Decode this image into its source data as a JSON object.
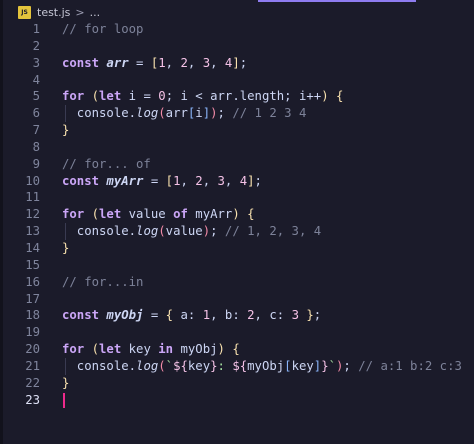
{
  "breadcrumb": {
    "file_icon_text": "JS",
    "file_name": "test.js",
    "separator": ">",
    "more": "..."
  },
  "editor": {
    "active_line": 23,
    "lines": [
      {
        "n": "1",
        "guide": false,
        "tokens": [
          {
            "t": "// for loop",
            "c": "comment"
          }
        ]
      },
      {
        "n": "2",
        "guide": false,
        "tokens": []
      },
      {
        "n": "3",
        "guide": false,
        "tokens": [
          {
            "t": "const ",
            "c": "keyword"
          },
          {
            "t": "arr",
            "c": "var"
          },
          {
            "t": " = ",
            "c": "op"
          },
          {
            "t": "[",
            "c": "bracket1"
          },
          {
            "t": "1",
            "c": "number"
          },
          {
            "t": ", ",
            "c": "punct"
          },
          {
            "t": "2",
            "c": "number"
          },
          {
            "t": ", ",
            "c": "punct"
          },
          {
            "t": "3",
            "c": "number"
          },
          {
            "t": ", ",
            "c": "punct"
          },
          {
            "t": "4",
            "c": "number"
          },
          {
            "t": "]",
            "c": "bracket1"
          },
          {
            "t": ";",
            "c": "punct"
          }
        ]
      },
      {
        "n": "4",
        "guide": false,
        "tokens": []
      },
      {
        "n": "5",
        "guide": false,
        "tokens": [
          {
            "t": "for ",
            "c": "keyword"
          },
          {
            "t": "(",
            "c": "bracket1"
          },
          {
            "t": "let ",
            "c": "keyword"
          },
          {
            "t": "i",
            "c": "ident"
          },
          {
            "t": " = ",
            "c": "op"
          },
          {
            "t": "0",
            "c": "number"
          },
          {
            "t": "; ",
            "c": "punct"
          },
          {
            "t": "i",
            "c": "ident"
          },
          {
            "t": " < ",
            "c": "op"
          },
          {
            "t": "arr",
            "c": "ident"
          },
          {
            "t": ".length; ",
            "c": "ident"
          },
          {
            "t": "i",
            "c": "ident"
          },
          {
            "t": "++",
            "c": "op"
          },
          {
            "t": ")",
            "c": "bracket1"
          },
          {
            "t": " ",
            "c": "punct"
          },
          {
            "t": "{",
            "c": "bracket1"
          }
        ]
      },
      {
        "n": "6",
        "guide": true,
        "tokens": [
          {
            "t": "  console.",
            "c": "ident"
          },
          {
            "t": "log",
            "c": "func"
          },
          {
            "t": "(",
            "c": "bracket2"
          },
          {
            "t": "arr",
            "c": "ident"
          },
          {
            "t": "[",
            "c": "bracket3"
          },
          {
            "t": "i",
            "c": "ident"
          },
          {
            "t": "]",
            "c": "bracket3"
          },
          {
            "t": ")",
            "c": "bracket2"
          },
          {
            "t": "; ",
            "c": "punct"
          },
          {
            "t": "// 1 2 3 4",
            "c": "comment"
          }
        ]
      },
      {
        "n": "7",
        "guide": false,
        "tokens": [
          {
            "t": "}",
            "c": "bracket1"
          }
        ]
      },
      {
        "n": "8",
        "guide": false,
        "tokens": []
      },
      {
        "n": "9",
        "guide": false,
        "tokens": [
          {
            "t": "// for... of",
            "c": "comment"
          }
        ]
      },
      {
        "n": "10",
        "guide": false,
        "tokens": [
          {
            "t": "const ",
            "c": "keyword"
          },
          {
            "t": "myArr",
            "c": "var"
          },
          {
            "t": " = ",
            "c": "op"
          },
          {
            "t": "[",
            "c": "bracket1"
          },
          {
            "t": "1",
            "c": "number"
          },
          {
            "t": ", ",
            "c": "punct"
          },
          {
            "t": "2",
            "c": "number"
          },
          {
            "t": ", ",
            "c": "punct"
          },
          {
            "t": "3",
            "c": "number"
          },
          {
            "t": ", ",
            "c": "punct"
          },
          {
            "t": "4",
            "c": "number"
          },
          {
            "t": "]",
            "c": "bracket1"
          },
          {
            "t": ";",
            "c": "punct"
          }
        ]
      },
      {
        "n": "11",
        "guide": false,
        "tokens": []
      },
      {
        "n": "12",
        "guide": false,
        "tokens": [
          {
            "t": "for ",
            "c": "keyword"
          },
          {
            "t": "(",
            "c": "bracket1"
          },
          {
            "t": "let ",
            "c": "keyword"
          },
          {
            "t": "value ",
            "c": "ident"
          },
          {
            "t": "of ",
            "c": "keyword"
          },
          {
            "t": "myArr",
            "c": "ident"
          },
          {
            "t": ")",
            "c": "bracket1"
          },
          {
            "t": " ",
            "c": "punct"
          },
          {
            "t": "{",
            "c": "bracket1"
          }
        ]
      },
      {
        "n": "13",
        "guide": true,
        "tokens": [
          {
            "t": "  console.",
            "c": "ident"
          },
          {
            "t": "log",
            "c": "func"
          },
          {
            "t": "(",
            "c": "bracket2"
          },
          {
            "t": "value",
            "c": "ident"
          },
          {
            "t": ")",
            "c": "bracket2"
          },
          {
            "t": "; ",
            "c": "punct"
          },
          {
            "t": "// 1, 2, 3, 4",
            "c": "comment"
          }
        ]
      },
      {
        "n": "14",
        "guide": false,
        "tokens": [
          {
            "t": "}",
            "c": "bracket1"
          }
        ]
      },
      {
        "n": "15",
        "guide": false,
        "tokens": []
      },
      {
        "n": "16",
        "guide": false,
        "tokens": [
          {
            "t": "// for...in",
            "c": "comment"
          }
        ]
      },
      {
        "n": "17",
        "guide": false,
        "tokens": []
      },
      {
        "n": "18",
        "guide": false,
        "tokens": [
          {
            "t": "const ",
            "c": "keyword"
          },
          {
            "t": "myObj",
            "c": "var"
          },
          {
            "t": " = ",
            "c": "op"
          },
          {
            "t": "{",
            "c": "bracket1"
          },
          {
            "t": " a: ",
            "c": "ident"
          },
          {
            "t": "1",
            "c": "number"
          },
          {
            "t": ", b: ",
            "c": "ident"
          },
          {
            "t": "2",
            "c": "number"
          },
          {
            "t": ", c: ",
            "c": "ident"
          },
          {
            "t": "3",
            "c": "number"
          },
          {
            "t": " ",
            "c": "punct"
          },
          {
            "t": "}",
            "c": "bracket1"
          },
          {
            "t": ";",
            "c": "punct"
          }
        ]
      },
      {
        "n": "19",
        "guide": false,
        "tokens": []
      },
      {
        "n": "20",
        "guide": false,
        "tokens": [
          {
            "t": "for ",
            "c": "keyword"
          },
          {
            "t": "(",
            "c": "bracket1"
          },
          {
            "t": "let ",
            "c": "keyword"
          },
          {
            "t": "key ",
            "c": "ident"
          },
          {
            "t": "in ",
            "c": "keyword"
          },
          {
            "t": "myObj",
            "c": "ident"
          },
          {
            "t": ")",
            "c": "bracket1"
          },
          {
            "t": " ",
            "c": "punct"
          },
          {
            "t": "{",
            "c": "bracket1"
          }
        ]
      },
      {
        "n": "21",
        "guide": true,
        "tokens": [
          {
            "t": "  console.",
            "c": "ident"
          },
          {
            "t": "log",
            "c": "func"
          },
          {
            "t": "(",
            "c": "bracket2"
          },
          {
            "t": "`",
            "c": "string"
          },
          {
            "t": "${",
            "c": "interp"
          },
          {
            "t": "key",
            "c": "ident"
          },
          {
            "t": "}",
            "c": "interp"
          },
          {
            "t": ": ",
            "c": "string"
          },
          {
            "t": "${",
            "c": "interp"
          },
          {
            "t": "myObj",
            "c": "ident"
          },
          {
            "t": "[",
            "c": "bracket3"
          },
          {
            "t": "key",
            "c": "ident"
          },
          {
            "t": "]",
            "c": "bracket3"
          },
          {
            "t": "}",
            "c": "interp"
          },
          {
            "t": "`",
            "c": "string"
          },
          {
            "t": ")",
            "c": "bracket2"
          },
          {
            "t": "; ",
            "c": "punct"
          },
          {
            "t": "// a:1 b:2 c:3",
            "c": "comment"
          }
        ]
      },
      {
        "n": "22",
        "guide": false,
        "tokens": [
          {
            "t": "}",
            "c": "bracket1"
          }
        ]
      },
      {
        "n": "23",
        "guide": false,
        "tokens": []
      }
    ]
  }
}
